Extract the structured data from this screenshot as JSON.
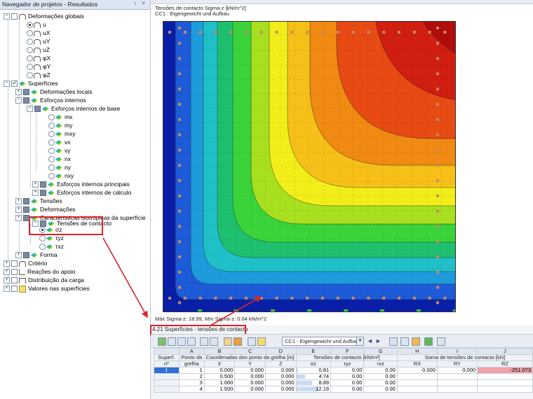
{
  "navigator": {
    "title": "Navegador de projetos - Resultados",
    "window_buttons": "‹ ×",
    "items": [
      {
        "label": "Deformações globais"
      },
      {
        "label": "u"
      },
      {
        "label": "uX"
      },
      {
        "label": "uY"
      },
      {
        "label": "uZ"
      },
      {
        "label": "φX"
      },
      {
        "label": "φY"
      },
      {
        "label": "φZ"
      },
      {
        "label": "Superfícies"
      },
      {
        "label": "Deformações locais"
      },
      {
        "label": "Esforços internos"
      },
      {
        "label": "Esforços internos de base"
      },
      {
        "label": "mx"
      },
      {
        "label": "my"
      },
      {
        "label": "mxy"
      },
      {
        "label": "vx"
      },
      {
        "label": "vy"
      },
      {
        "label": "nx"
      },
      {
        "label": "ny"
      },
      {
        "label": "nxy"
      },
      {
        "label": "Esforços internos principais"
      },
      {
        "label": "Esforços internos de cálculo"
      },
      {
        "label": "Tensões"
      },
      {
        "label": "Deformações"
      },
      {
        "label": "Características isotrópicas da superfície"
      },
      {
        "label": "Tensões de contacto"
      },
      {
        "label": "σz"
      },
      {
        "label": "τyz"
      },
      {
        "label": "τxz"
      },
      {
        "label": "Forma"
      },
      {
        "label": "Critério"
      },
      {
        "label": "Reações do apoio"
      },
      {
        "label": "Distribuição da carga"
      },
      {
        "label": "Valores nas superfícies"
      }
    ]
  },
  "plot": {
    "title_line1": "Tensões de contacto Sigma-z [kN/m^2]",
    "title_line2": "CC1 : Eigengewicht und Aufbau",
    "footer": "Máx Sigma-z: 18.99, Mín Sigma-z: 0.04 kN/m^2",
    "colors": [
      "#0a1fa8",
      "#1e5bd8",
      "#1e9bdc",
      "#20c0c8",
      "#1ec070",
      "#3ad43a",
      "#a8e020",
      "#f2ee1a",
      "#f6c018",
      "#f08a12",
      "#e84a14",
      "#d01e10",
      "#b00c0c"
    ]
  },
  "table_panel": {
    "title": "4.21 Superfícies - tensões de contacto",
    "load_case": "CC1 - Eigengewicht und Aufbau",
    "col_letters": [
      "A",
      "B",
      "C",
      "D",
      "E",
      "F",
      "G",
      "H",
      "I",
      "J"
    ],
    "header1": {
      "superf": "Superf.",
      "ponto": "Ponto da",
      "coords": "Coordenadas dos ponto da grelha [m]",
      "tensoes": "Tensões de contacto [kN/m²]",
      "soma": "Soma de tensões de contacto [kN]"
    },
    "header2": {
      "nr": "nº",
      "grelha": "grelha",
      "x": "X",
      "y": "Y",
      "z": "Z",
      "sz": "σz",
      "tyz": "τyz",
      "txz": "τxz",
      "rx": "RX",
      "ry": "RY",
      "rz": "RZ"
    },
    "rows": [
      {
        "superf": "1",
        "grelha": "1",
        "x": "0.000",
        "y": "0.000",
        "z": "0.000",
        "sz": "0.81",
        "tyz": "0.00",
        "txz": "0.00",
        "rx": "0.000",
        "ry": "0.000",
        "rz": "-251.073",
        "bar": 0.04
      },
      {
        "superf": "",
        "grelha": "2",
        "x": "0.500",
        "y": "0.000",
        "z": "0.000",
        "sz": "4.74",
        "tyz": "0.00",
        "txz": "0.00",
        "rx": "",
        "ry": "",
        "rz": "",
        "bar": 0.25
      },
      {
        "superf": "",
        "grelha": "3",
        "x": "1.000",
        "y": "0.000",
        "z": "0.000",
        "sz": "8.89",
        "tyz": "0.00",
        "txz": "0.00",
        "rx": "",
        "ry": "",
        "rz": "",
        "bar": 0.47
      },
      {
        "superf": "",
        "grelha": "4",
        "x": "1.500",
        "y": "0.000",
        "z": "0.000",
        "sz": "12.19",
        "tyz": "0.00",
        "txz": "0.00",
        "rx": "",
        "ry": "",
        "rz": "",
        "bar": 0.64
      }
    ]
  }
}
